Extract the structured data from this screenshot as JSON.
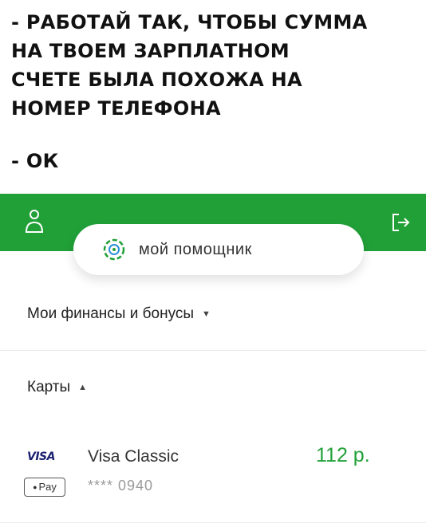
{
  "caption": {
    "lines": [
      "- РАБОТАЙ ТАК, ЧТОБЫ СУММА",
      "НА ТВОЕМ ЗАРПЛАТНОМ",
      "СЧЕТЕ БЫЛА ПОХОЖА НА",
      "НОМЕР ТЕЛЕФОНА"
    ],
    "reply": "- ОК"
  },
  "header": {
    "brand_color": "#21a038",
    "user_icon": "user-icon",
    "logout_icon": "logout-icon"
  },
  "assistant": {
    "label": "мой помощник",
    "icon": "assistant-ring-icon"
  },
  "finances": {
    "label": "Мои финансы и бонусы",
    "caret": "▼"
  },
  "cards": {
    "label": "Карты",
    "caret": "▲",
    "items": [
      {
        "brand": "VISA",
        "pay_badge": "Pay",
        "name": "Visa Classic",
        "number": "**** 0940",
        "balance": "112 р."
      }
    ]
  }
}
